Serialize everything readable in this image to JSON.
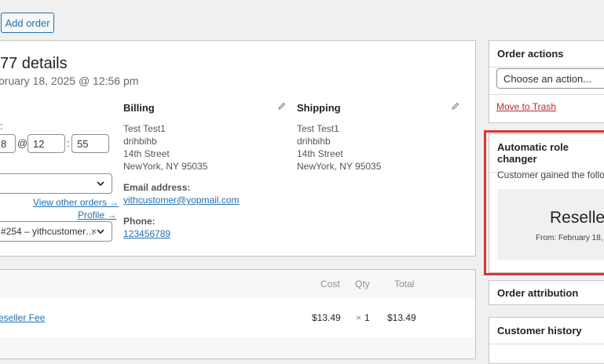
{
  "header": {
    "add_order_label": "Add order"
  },
  "order": {
    "title": "77 details",
    "date_line": "bruary 18, 2025 @ 12:56 pm",
    "time_label": ":",
    "date_fragment": "8",
    "at_sign": "@",
    "hour": "12",
    "colon": ":",
    "minute": "55",
    "view_other_orders": "View other orders →",
    "profile_link": "Profile →",
    "customer_select": "#254 – yithcustomer…",
    "customer_clear": "×"
  },
  "billing": {
    "heading": "Billing",
    "address": [
      "Test Test1",
      "drihbihb",
      "14th Street",
      "NewYork, NY 95035"
    ],
    "email_label": "Email address:",
    "email": "yithcustomer@yopmail.com",
    "phone_label": "Phone:",
    "phone": "123456789"
  },
  "shipping": {
    "heading": "Shipping",
    "address": [
      "Test Test1",
      "drihbihb",
      "14th Street",
      "NewYork, NY 95035"
    ]
  },
  "items": {
    "columns": {
      "cost": "Cost",
      "qty": "Qty",
      "total": "Total"
    },
    "rows": [
      {
        "name": "eseller Fee",
        "cost": "$13.49",
        "qty_mult": "×",
        "qty": "1",
        "total": "$13.49"
      }
    ]
  },
  "sidebar": {
    "order_actions": {
      "title": "Order actions",
      "select_placeholder": "Choose an action...",
      "trash_link": "Move to Trash"
    },
    "role_changer": {
      "title": "Automatic role changer",
      "text": "Customer gained the follow",
      "role": "Reselle",
      "from": "From: February 18,"
    },
    "order_attribution": {
      "title": "Order attribution"
    },
    "customer_history": {
      "title": "Customer history"
    }
  },
  "colors": {
    "link": "#2271b1",
    "trash": "#b32d2e",
    "highlight": "#d63638"
  }
}
